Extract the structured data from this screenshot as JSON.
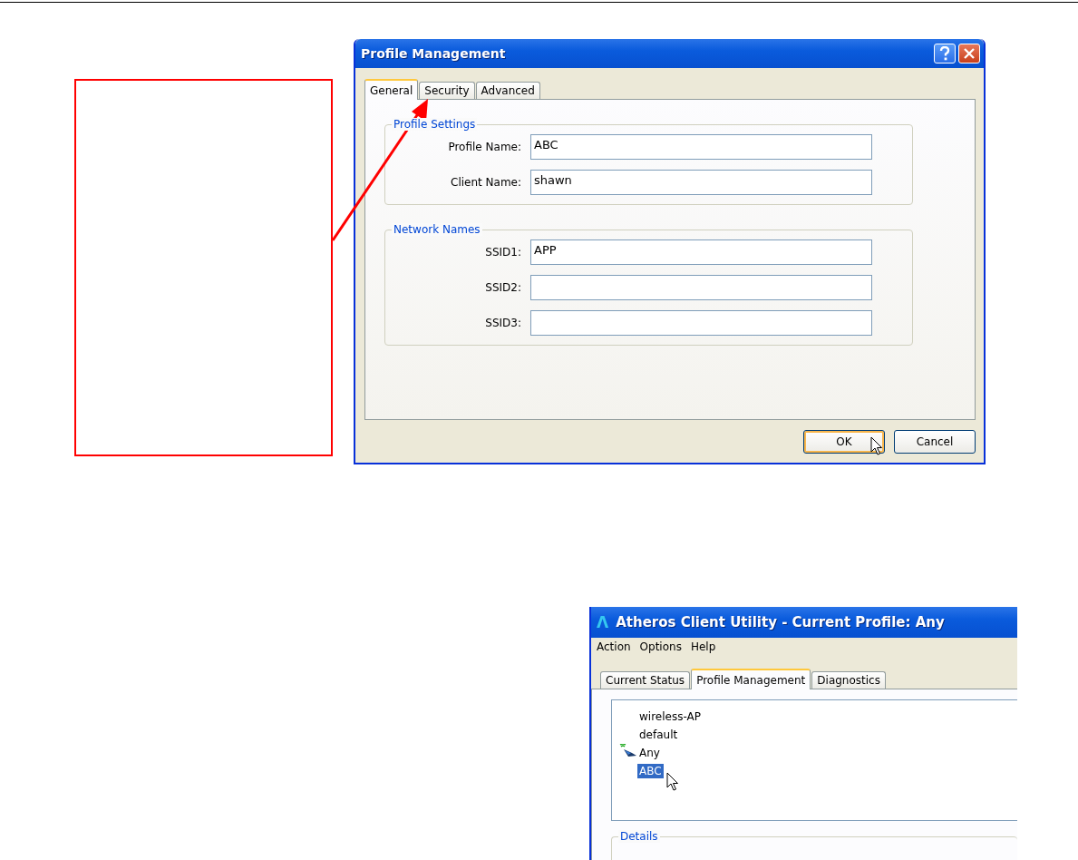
{
  "dialog": {
    "title": "Profile Management",
    "tabs": [
      {
        "label": "General",
        "selected": true
      },
      {
        "label": "Security",
        "selected": false
      },
      {
        "label": "Advanced",
        "selected": false
      }
    ],
    "groups": [
      {
        "legend": "Profile Settings",
        "fields": [
          {
            "label": "Profile Name:",
            "value": "ABC"
          },
          {
            "label": "Client Name:",
            "value": "shawn"
          }
        ]
      },
      {
        "legend": "Network Names",
        "fields": [
          {
            "label": "SSID1:",
            "value": "APP"
          },
          {
            "label": "SSID2:"
          },
          {
            "label": "SSID3:"
          }
        ]
      }
    ],
    "buttons": [
      {
        "label": "OK",
        "default": true
      },
      {
        "label": "Cancel",
        "default": false
      }
    ]
  },
  "utility": {
    "logo": "Λ",
    "title": "Atheros Client Utility - Current Profile: Any",
    "menu": [
      "Action",
      "Options",
      "Help"
    ],
    "tabs": [
      {
        "label": "Current Status",
        "selected": false
      },
      {
        "label": "Profile Management",
        "selected": true
      },
      {
        "label": "Diagnostics",
        "selected": false
      }
    ],
    "profiles": [
      {
        "name": "wireless-AP",
        "selected": false,
        "active": false
      },
      {
        "name": "default",
        "selected": false,
        "active": false
      },
      {
        "name": "Any",
        "selected": false,
        "active": true
      },
      {
        "name": "ABC",
        "selected": true,
        "active": false
      }
    ],
    "details": {
      "legend": "Details"
    }
  }
}
